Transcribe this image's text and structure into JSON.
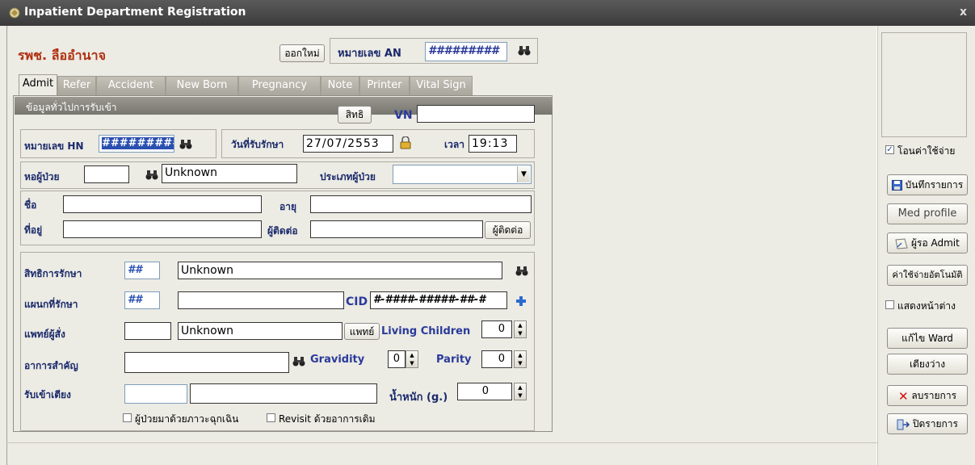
{
  "window": {
    "title": "Inpatient Department Registration",
    "close": "x"
  },
  "header": {
    "hospital": "รพช. ลืออำนาจ",
    "new_button": "ออกใหม่",
    "an_label": "หมายเลข AN",
    "an_value": "#########"
  },
  "tabs": [
    "Admit",
    "Refer",
    "Accident",
    "New Born",
    "Pregnancy",
    "Note",
    "Printer",
    "Vital Sign"
  ],
  "group": {
    "title": "ข้อมูลทั่วไปการรับเข้า",
    "rights_button": "สิทธิ",
    "vn_label": "VN",
    "vn_value": ""
  },
  "admit": {
    "hn_label": "หมายเลข HN",
    "hn_value": "#########",
    "date_label": "วันที่รับรักษา",
    "date_value": "27/07/2553",
    "time_label": "เวลา",
    "time_value": "19:13",
    "ward_label": "หอผู้ป่วย",
    "ward_code": "",
    "ward_name": "Unknown",
    "ptype_label": "ประเภทผู้ป่วย",
    "ptype_value": "",
    "name_label": "ชื่อ",
    "name_value": "",
    "age_label": "อายุ",
    "age_value": "",
    "address_label": "ที่อยู่",
    "address_value": "",
    "contact_label": "ผู้ติดต่อ",
    "contact_value": "",
    "contact_button": "ผู้ติดต่อ",
    "right_label": "สิทธิการรักษา",
    "right_code": "##",
    "right_name": "Unknown",
    "dept_label": "แผนกที่รักษา",
    "dept_code": "##",
    "dept_name": "",
    "cid_label": "CID",
    "cid_value": "#-####-#####-##-#",
    "doctor_label": "แพทย์ผู้สั่ง",
    "doctor_code": "",
    "doctor_name": "Unknown",
    "doctor_button": "แพทย์",
    "living_children_label": "Living Children",
    "living_children_value": "0",
    "symptom_label": "อาการสำคัญ",
    "symptom_value": "",
    "gravidity_label": "Gravidity",
    "gravidity_value": "0",
    "parity_label": "Parity",
    "parity_value": "0",
    "bed_label": "รับเข้าเตียง",
    "bed_code": "",
    "bed_name": "",
    "weight_label": "น้ำหนัก (g.)",
    "weight_value": "0",
    "emergency_label": "ผู้ป่วยมาด้วยภาวะฉุกเฉิน",
    "revisit_label": "Revisit ด้วยอาการเดิม"
  },
  "sidebar": {
    "transfer_cost_label": "โอนค่าใช้จ่าย",
    "save_button": "บันทึกรายการ",
    "med_profile_button": "Med profile",
    "waiting_admit_button": "ผู้รอ Admit",
    "auto_cost_button": "ค่าใช้จ่ายอัตโนมัติ",
    "show_window_label": "แสดงหน้าต่าง",
    "edit_ward_button": "แก้ไข Ward",
    "empty_bed_button": "เตียงว่าง",
    "delete_button": "ลบรายการ",
    "close_button": "ปิดรายการ"
  },
  "colors": {
    "accent": "#2a4fb0",
    "hospital": "#b03010",
    "titlebar": "#444444"
  }
}
